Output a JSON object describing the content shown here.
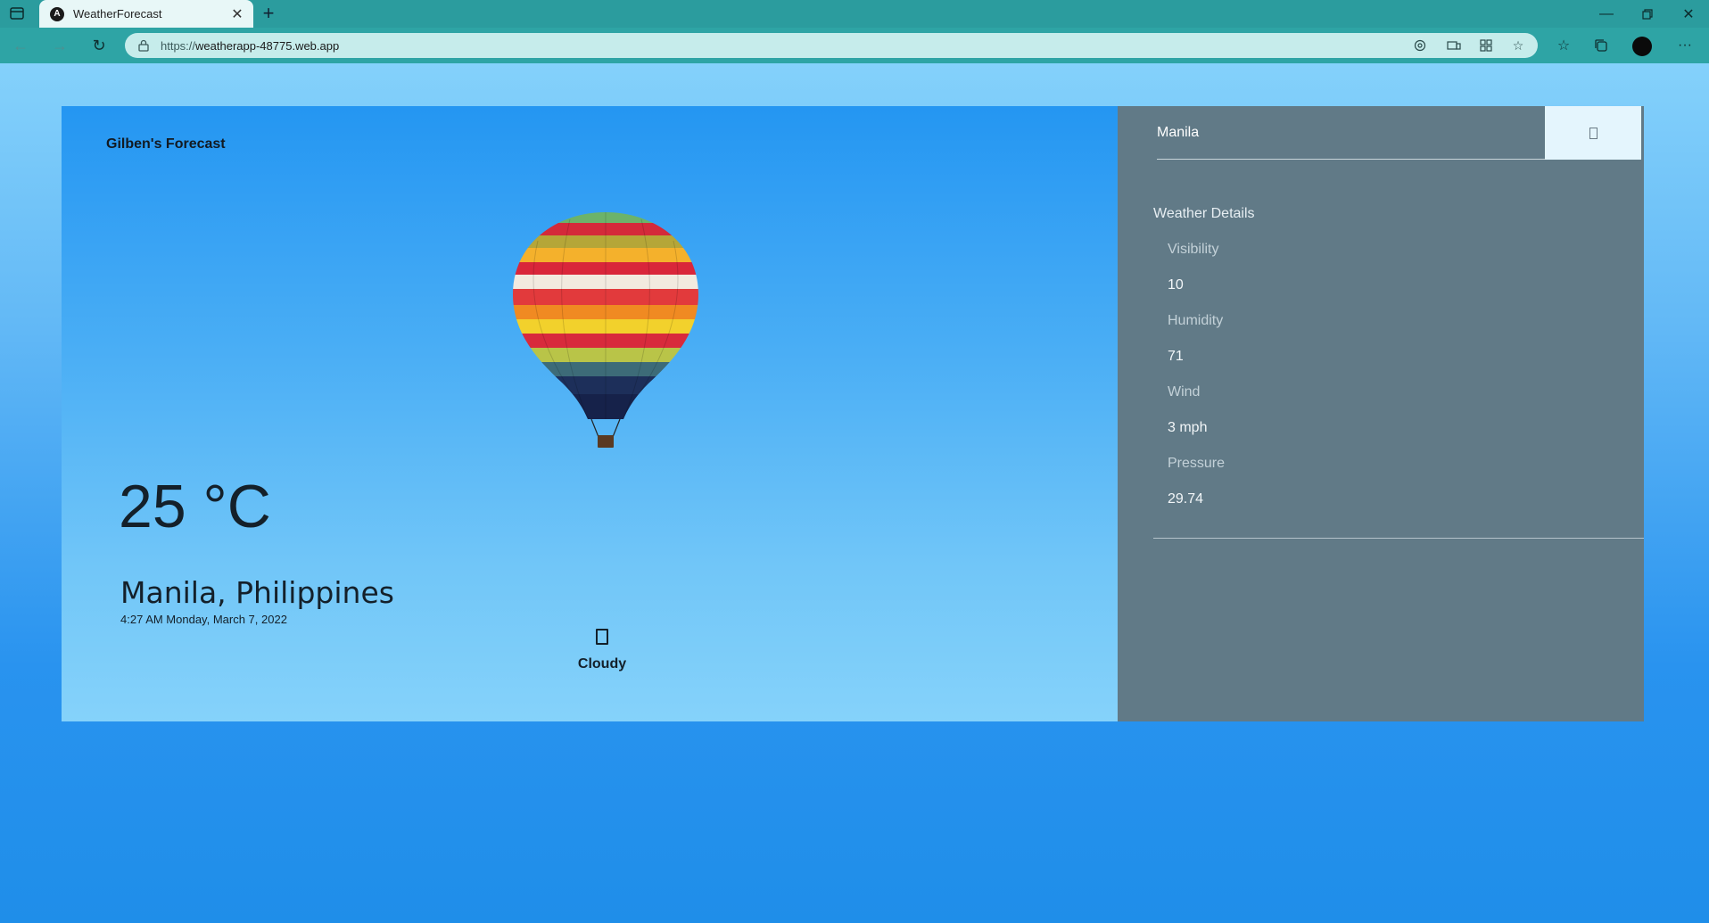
{
  "browser": {
    "tab_title": "WeatherForecast",
    "tab_favicon_letter": "A",
    "url_protocol": "https://",
    "url_host": "weatherapp-48775.web.app"
  },
  "app": {
    "brand": "Gilben's Forecast",
    "temperature": "25 °C",
    "location": "Manila, Philippines",
    "datetime": "4:27 AM Monday, March 7, 2022",
    "condition": "Cloudy"
  },
  "search": {
    "value": "Manila"
  },
  "details": {
    "heading": "Weather Details",
    "items": [
      {
        "label": "Visibility",
        "value": "10"
      },
      {
        "label": "Humidity",
        "value": "71"
      },
      {
        "label": "Wind",
        "value": "3 mph"
      },
      {
        "label": "Pressure",
        "value": "29.74"
      }
    ]
  },
  "icons": {
    "back": "arrow-left-icon",
    "forward": "arrow-right-icon",
    "refresh": "refresh-icon",
    "lock": "lock-icon",
    "condition": "cloud-icon",
    "search": "search-icon"
  }
}
